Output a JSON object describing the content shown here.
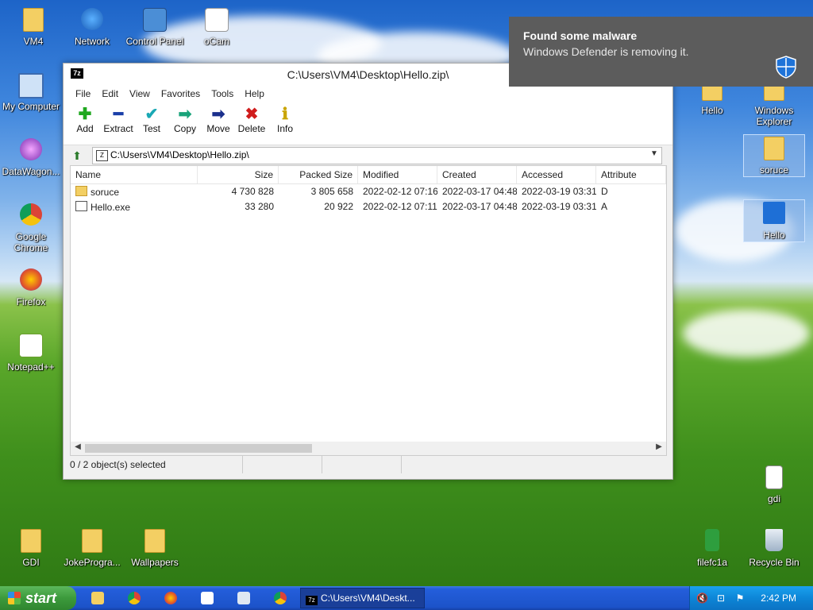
{
  "desktop": {
    "icons_left": [
      {
        "label": "VM4",
        "icon": "user-folder-icon"
      },
      {
        "label": "Network",
        "icon": "network-icon"
      },
      {
        "label": "Control Panel",
        "icon": "control-panel-icon"
      },
      {
        "label": "oCam",
        "icon": "ocam-icon"
      },
      {
        "label": "My Computer",
        "icon": "computer-icon"
      },
      {
        "label": "DataWagon...",
        "icon": "datawagon-icon"
      },
      {
        "label": "Google Chrome",
        "icon": "chrome-icon"
      },
      {
        "label": "Firefox",
        "icon": "firefox-icon"
      },
      {
        "label": "Notepad++",
        "icon": "notepadpp-icon"
      }
    ],
    "icons_right": [
      {
        "label": "Hello",
        "icon": "folder-icon"
      },
      {
        "label": "Windows Explorer",
        "icon": "explorer-icon"
      },
      {
        "label": "soruce",
        "icon": "folder-icon"
      },
      {
        "label": "Hello",
        "icon": "exe-icon"
      },
      {
        "label": "gdi",
        "icon": "document-icon"
      },
      {
        "label": "filefc1a",
        "icon": "green-file-icon"
      },
      {
        "label": "Recycle Bin",
        "icon": "recycle-bin-icon"
      }
    ],
    "icons_bottom": [
      {
        "label": "GDI",
        "icon": "folder-icon"
      },
      {
        "label": "JokeProgra...",
        "icon": "folder-icon"
      },
      {
        "label": "Wallpapers",
        "icon": "folder-icon"
      }
    ]
  },
  "window": {
    "app_icon_text": "7z",
    "title": "C:\\Users\\VM4\\Desktop\\Hello.zip\\",
    "menu": [
      "File",
      "Edit",
      "View",
      "Favorites",
      "Tools",
      "Help"
    ],
    "toolbar": [
      {
        "label": "Add",
        "glyph": "✚",
        "color": "#1fa81f"
      },
      {
        "label": "Extract",
        "glyph": "━",
        "color": "#1a3fa8"
      },
      {
        "label": "Test",
        "glyph": "✔",
        "color": "#19a8b4"
      },
      {
        "label": "Copy",
        "glyph": "➡",
        "color": "#19a37a"
      },
      {
        "label": "Move",
        "glyph": "➡",
        "color": "#1a2f8c"
      },
      {
        "label": "Delete",
        "glyph": "✖",
        "color": "#d01c1c"
      },
      {
        "label": "Info",
        "glyph": "ℹ",
        "color": "#c9a400"
      }
    ],
    "address": "C:\\Users\\VM4\\Desktop\\Hello.zip\\",
    "columns": [
      "Name",
      "Size",
      "Packed Size",
      "Modified",
      "Created",
      "Accessed",
      "Attribute"
    ],
    "rows": [
      {
        "name": "soruce",
        "type": "folder",
        "size": "4 730 828",
        "packed": "3 805 658",
        "modified": "2022-02-12 07:16",
        "created": "2022-03-17 04:48",
        "accessed": "2022-03-19 03:31",
        "attr": "D"
      },
      {
        "name": "Hello.exe",
        "type": "exe",
        "size": "33 280",
        "packed": "20 922",
        "modified": "2022-02-12 07:11",
        "created": "2022-03-17 04:48",
        "accessed": "2022-03-19 03:31",
        "attr": "A"
      }
    ],
    "status": "0 / 2 object(s) selected"
  },
  "toast": {
    "title": "Found some malware",
    "message": "Windows Defender is removing it."
  },
  "taskbar": {
    "start_label": "start",
    "task_icon_text": "7z",
    "task_label": "C:\\Users\\VM4\\Deskt...",
    "clock": "2:42 PM"
  },
  "colors": {
    "taskbar": "#245edb",
    "start": "#3c9a3c",
    "tray": "#0d86d7",
    "toast": "#5c5c5c"
  }
}
